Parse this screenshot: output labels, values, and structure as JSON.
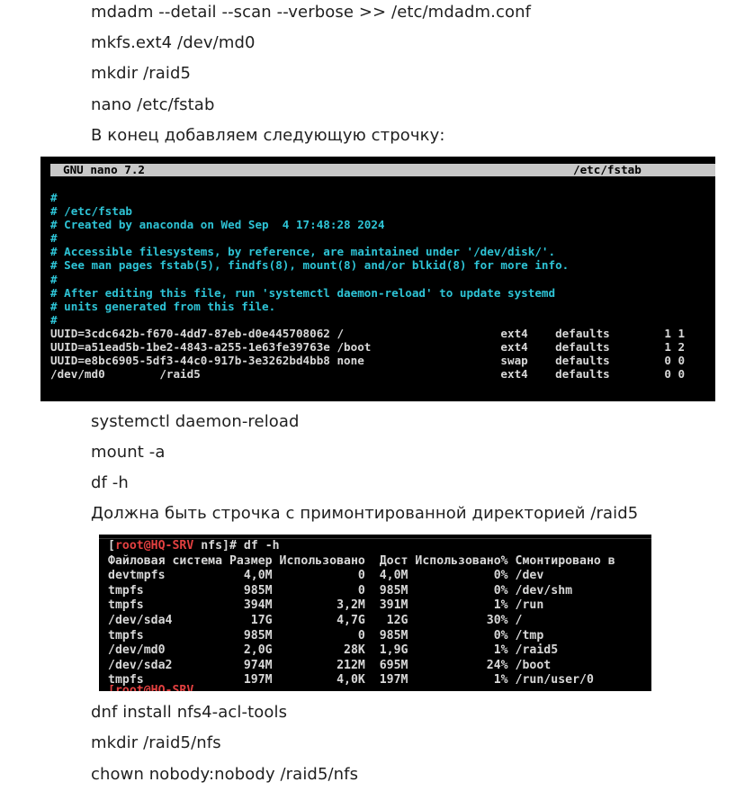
{
  "text_lines_top": [
    "mdadm --detail --scan --verbose >> /etc/mdadm.conf",
    "mkfs.ext4 /dev/md0",
    "mkdir /raid5",
    "nano /etc/fstab",
    "В конец добавляем следующую строчку:"
  ],
  "nano": {
    "app_title": "GNU nano 7.2",
    "file_name": "/etc/fstab",
    "comments": [
      "#",
      "# /etc/fstab",
      "# Created by anaconda on Wed Sep  4 17:48:28 2024",
      "#",
      "# Accessible filesystems, by reference, are maintained under '/dev/disk/'.",
      "# See man pages fstab(5), findfs(8), mount(8) and/or blkid(8) for more info.",
      "#",
      "# After editing this file, run 'systemctl daemon-reload' to update systemd",
      "# units generated from this file.",
      "#"
    ],
    "entries": [
      "UUID=3cdc642b-f670-4dd7-87eb-d0e445708062 /                       ext4    defaults        1 1",
      "UUID=a51ead5b-1be2-4843-a255-1e63fe39763e /boot                   ext4    defaults        1 2",
      "UUID=e8bc6905-5df3-44c0-917b-3e3262bd4bb8 none                    swap    defaults        0 0",
      "/dev/md0        /raid5                                            ext4    defaults        0 0"
    ]
  },
  "text_lines_middle": [
    "systemctl daemon-reload",
    "mount -a",
    "df -h",
    "Должна быть строчка с примонтированной директорией /raid5"
  ],
  "df": {
    "prompt_open": "[",
    "prompt_user": "root@HQ-SRV",
    "prompt_dir": " nfs]",
    "prompt_hash": "# ",
    "command": "df -h",
    "rows": [
      "Файловая система Размер Использовано  Дост Использовано% Смонтировано в",
      "devtmpfs           4,0M            0  4,0M            0% /dev",
      "tmpfs              985M            0  985M            0% /dev/shm",
      "tmpfs              394M         3,2M  391M            1% /run",
      "/dev/sda4           17G         4,7G   12G           30% /",
      "tmpfs              985M            0  985M            0% /tmp",
      "/dev/md0           2,0G          28K  1,9G            1% /raid5",
      "/dev/sda2          974M         212M  695M           24% /boot",
      "tmpfs              197M         4,0K  197M            1% /run/user/0"
    ],
    "cut_prompt": "[root@HQ-SRV"
  },
  "text_lines_bottom": [
    "dnf install nfs4-acl-tools",
    "mkdir /raid5/nfs",
    "chown nobody:nobody /raid5/nfs"
  ]
}
